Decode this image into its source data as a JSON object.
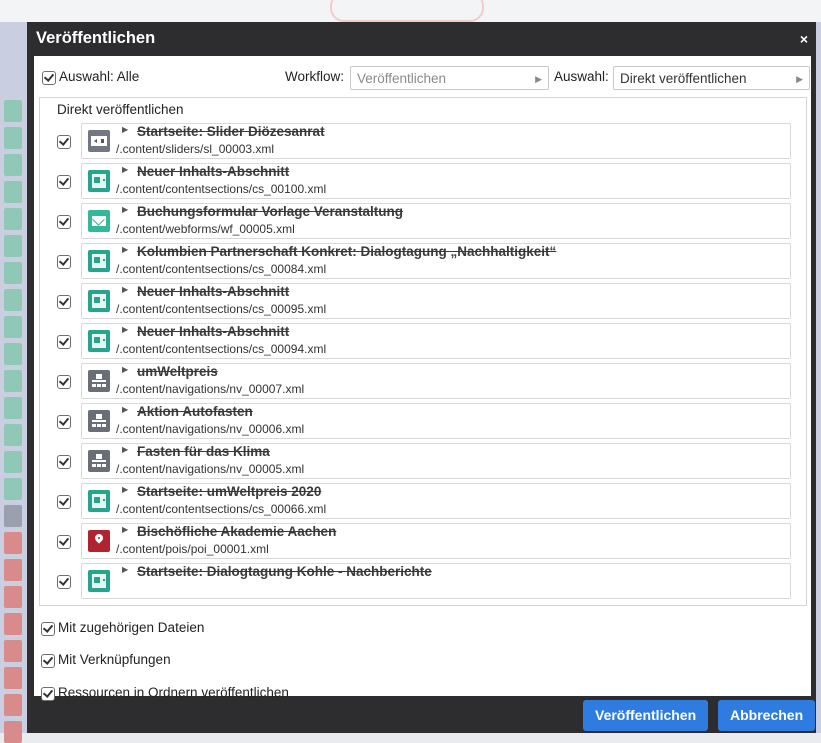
{
  "dialog": {
    "title": "Veröffentlichen",
    "close_glyph": "×"
  },
  "toolbar": {
    "select_all_label": "Auswahl: Alle",
    "workflow_label": "Workflow:",
    "workflow_value": "Veröffentlichen",
    "selection_label": "Auswahl:",
    "selection_value": "Direkt veröffentlichen"
  },
  "list": {
    "heading": "Direkt veröffentlichen",
    "items": [
      {
        "title": "Startseite: Slider Diözesanrat",
        "path": "/.content/sliders/sl_00003.xml",
        "icon": "slider-icon",
        "checked": true
      },
      {
        "title": "Neuer Inhalts-Abschnitt",
        "path": "/.content/contentsections/cs_00100.xml",
        "icon": "contentsection-icon",
        "checked": true
      },
      {
        "title": "Buchungsformular Vorlage Veranstaltung",
        "path": "/.content/webforms/wf_00005.xml",
        "icon": "webform-icon",
        "checked": true
      },
      {
        "title": "Kolumbien Partnerschaft Konkret: Dialogtagung „Nachhaltigkeit“",
        "path": "/.content/contentsections/cs_00084.xml",
        "icon": "contentsection-icon",
        "checked": true
      },
      {
        "title": "Neuer Inhalts-Abschnitt",
        "path": "/.content/contentsections/cs_00095.xml",
        "icon": "contentsection-icon",
        "checked": true
      },
      {
        "title": "Neuer Inhalts-Abschnitt",
        "path": "/.content/contentsections/cs_00094.xml",
        "icon": "contentsection-icon",
        "checked": true
      },
      {
        "title": "umWeltpreis",
        "path": "/.content/navigations/nv_00007.xml",
        "icon": "navigation-icon",
        "checked": true
      },
      {
        "title": "Aktion Autofasten",
        "path": "/.content/navigations/nv_00006.xml",
        "icon": "navigation-icon",
        "checked": true
      },
      {
        "title": "Fasten für das Klima",
        "path": "/.content/navigations/nv_00005.xml",
        "icon": "navigation-icon",
        "checked": true
      },
      {
        "title": "Startseite: umWeltpreis 2020",
        "path": "/.content/contentsections/cs_00066.xml",
        "icon": "contentsection-icon",
        "checked": true
      },
      {
        "title": "Bischöfliche Akademie Aachen",
        "path": "/.content/pois/poi_00001.xml",
        "icon": "poi-icon",
        "checked": true
      },
      {
        "title": "Startseite: Dialogtagung Kohle - Nachberichte",
        "path": "",
        "icon": "contentsection-icon",
        "checked": true
      }
    ]
  },
  "options": {
    "related_files_label": "Mit zugehörigen Dateien",
    "links_label": "Mit Verknüpfungen",
    "folder_resources_label": "Ressourcen in Ordnern veröffentlichen"
  },
  "buttons": {
    "publish_label": "Veröffentlichen",
    "cancel_label": "Abbrechen"
  },
  "colors": {
    "title_bar": "#2d2d30",
    "button_blue": "#2f7ce0",
    "contentsection_green": "#27a48c",
    "poi_red": "#b0232f"
  }
}
